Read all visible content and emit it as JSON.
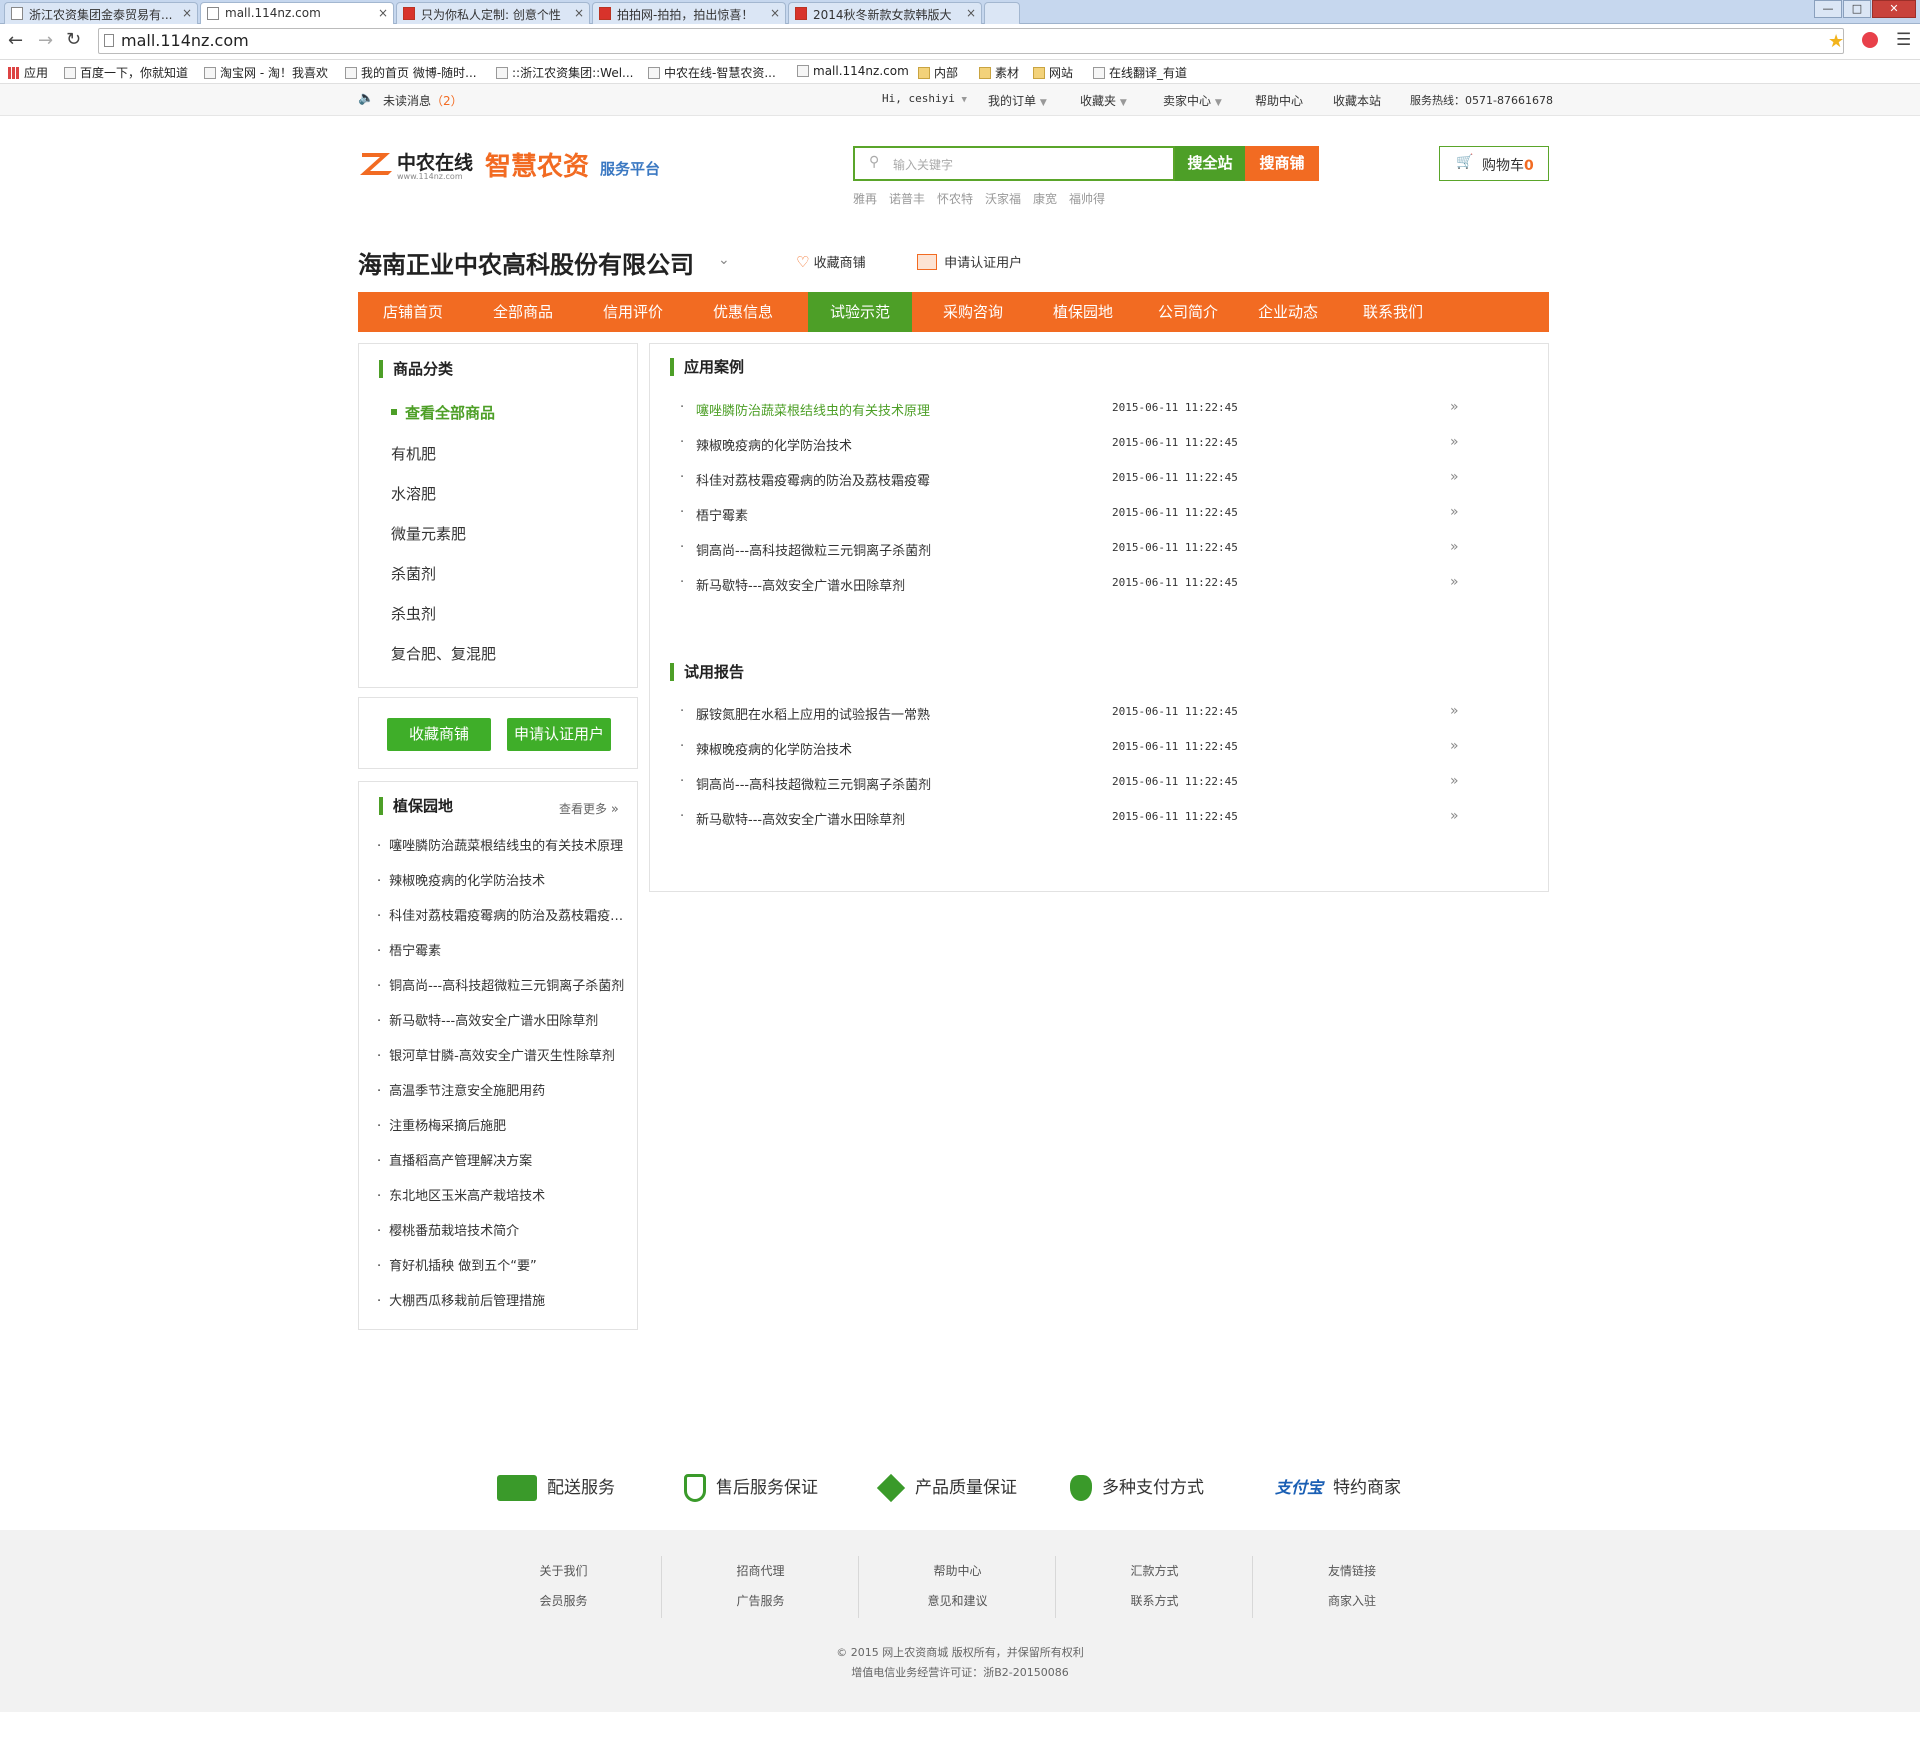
{
  "browser": {
    "tabs": [
      {
        "title": "浙江农资集团金泰贸易有...",
        "active": false,
        "icon": "page-icon"
      },
      {
        "title": "mall.114nz.com",
        "active": true,
        "icon": "page-icon"
      },
      {
        "title": "只为你私人定制: 创意个性",
        "active": false,
        "icon": "tmall-icon"
      },
      {
        "title": "拍拍网-拍拍，拍出惊喜！",
        "active": false,
        "icon": "paipai-icon"
      },
      {
        "title": "2014秋冬新款女款韩版大",
        "active": false,
        "icon": "paipai-icon"
      }
    ],
    "url": "mall.114nz.com",
    "bookmarks": [
      {
        "label": "应用",
        "icon": "apps-grid-icon"
      },
      {
        "label": "百度一下，你就知道",
        "icon": "baidu-icon"
      },
      {
        "label": "淘宝网 - 淘！我喜欢",
        "icon": "taobao-icon"
      },
      {
        "label": "我的首页 微博-随时...",
        "icon": "weibo-icon"
      },
      {
        "label": "::浙江农资集团::Wel...",
        "icon": "zj-icon"
      },
      {
        "label": "中农在线-智慧农资...",
        "icon": "page-icon"
      },
      {
        "label": "mall.114nz.com",
        "icon": "page-icon"
      },
      {
        "label": "内部",
        "icon": "folder-icon"
      },
      {
        "label": "素材",
        "icon": "folder-icon"
      },
      {
        "label": "网站",
        "icon": "folder-icon"
      },
      {
        "label": "在线翻译_有道",
        "icon": "youdao-icon"
      }
    ]
  },
  "topbar": {
    "unread_label": "未读消息",
    "unread_count": "（2）",
    "greeting": "Hi, ceshiyi",
    "my_orders": "我的订单",
    "favorites": "收藏夹",
    "seller_center": "卖家中心",
    "help_center": "帮助中心",
    "bookmark_site": "收藏本站",
    "hotline": "服务热线：0571-87661678"
  },
  "header": {
    "logo_name": "中农在线",
    "logo_url": "www.114nz.com",
    "slogan_main": "智慧农资",
    "slogan_sub": "服务平台",
    "search_placeholder": "输入关键字",
    "search_all_button": "搜全站",
    "search_shop_button": "搜商铺",
    "hot_keywords": [
      "雅再",
      "诺普丰",
      "怀农特",
      "沃家福",
      "康宽",
      "福帅得"
    ],
    "cart_label": "购物车",
    "cart_count": "0"
  },
  "shop": {
    "name": "海南正业中农高科股份有限公司",
    "favorite_label": "收藏商铺",
    "certify_label": "申请认证用户"
  },
  "nav": {
    "items": [
      "店铺首页",
      "全部商品",
      "信用评价",
      "优惠信息",
      "试验示范",
      "采购咨询",
      "植保园地",
      "公司简介",
      "企业动态",
      "联系我们"
    ],
    "active_index": 4
  },
  "sidebar": {
    "category_title": "商品分类",
    "view_all": "查看全部商品",
    "categories": [
      "有机肥",
      "水溶肥",
      "微量元素肥",
      "杀菌剂",
      "杀虫剂",
      "复合肥、复混肥"
    ],
    "favorite_button": "收藏商铺",
    "certify_button": "申请认证用户",
    "plant_title": "植保园地",
    "more_label": "查看更多",
    "plant_items": [
      "噻唑膦防治蔬菜根结线虫的有关技术原理",
      "辣椒晚疫病的化学防治技术",
      "科佳对荔枝霜疫霉病的防治及荔枝霜疫霉...",
      "梧宁霉素",
      "铜高尚---高科技超微粒三元铜离子杀菌剂",
      "新马歇特---高效安全广谱水田除草剂",
      "银河草甘膦-高效安全广谱灭生性除草剂",
      "高温季节注意安全施肥用药",
      "注重杨梅采摘后施肥",
      "直播稻高产管理解决方案",
      "东北地区玉米高产栽培技术",
      "樱桃番茄栽培技术简介",
      "育好机插秧 做到五个“要”",
      "大棚西瓜移栽前后管理措施"
    ]
  },
  "main": {
    "cases_title": "应用案例",
    "cases": [
      {
        "title": "噻唑膦防治蔬菜根结线虫的有关技术原理",
        "date": "2015-06-11 11:22:45",
        "highlight": true
      },
      {
        "title": "辣椒晚疫病的化学防治技术",
        "date": "2015-06-11 11:22:45",
        "highlight": false
      },
      {
        "title": "科佳对荔枝霜疫霉病的防治及荔枝霜疫霉",
        "date": "2015-06-11 11:22:45",
        "highlight": false
      },
      {
        "title": "梧宁霉素",
        "date": "2015-06-11 11:22:45",
        "highlight": false
      },
      {
        "title": "铜高尚---高科技超微粒三元铜离子杀菌剂",
        "date": "2015-06-11 11:22:45",
        "highlight": false
      },
      {
        "title": "新马歇特---高效安全广谱水田除草剂",
        "date": "2015-06-11 11:22:45",
        "highlight": false
      }
    ],
    "reports_title": "试用报告",
    "reports": [
      {
        "title": "脲铵氮肥在水稻上应用的试验报告一常熟",
        "date": "2015-06-11 11:22:45"
      },
      {
        "title": "辣椒晚疫病的化学防治技术",
        "date": "2015-06-11 11:22:45"
      },
      {
        "title": "铜高尚---高科技超微粒三元铜离子杀菌剂",
        "date": "2015-06-11 11:22:45"
      },
      {
        "title": "新马歇特---高效安全广谱水田除草剂",
        "date": "2015-06-11 11:22:45"
      }
    ],
    "more_glyph": "»"
  },
  "services": [
    {
      "label": "配送服务",
      "icon": "truck-icon"
    },
    {
      "label": "售后服务保证",
      "icon": "shield-icon"
    },
    {
      "label": "产品质量保证",
      "icon": "diamond-icon"
    },
    {
      "label": "多种支付方式",
      "icon": "money-bag-icon"
    },
    {
      "label": "特约商家",
      "icon": "alipay-icon",
      "icon_text": "支付宝"
    }
  ],
  "footer": {
    "columns": [
      [
        "关于我们",
        "会员服务"
      ],
      [
        "招商代理",
        "广告服务"
      ],
      [
        "帮助中心",
        "意见和建议"
      ],
      [
        "汇款方式",
        "联系方式"
      ],
      [
        "友情链接",
        "商家入驻"
      ]
    ],
    "copyright": "© 2015  网上农资商城  版权所有，并保留所有权利",
    "license": "增值电信业务经营许可证：浙B2-20150086"
  },
  "colors": {
    "orange": "#f26b22",
    "green": "#4d9f27",
    "button_green": "#3fae29",
    "link_green": "#4d9f27"
  }
}
